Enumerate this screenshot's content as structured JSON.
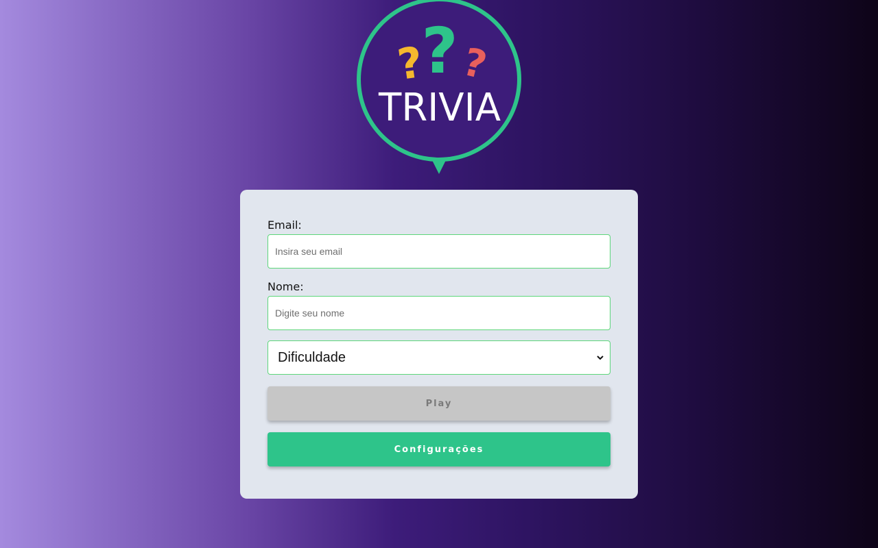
{
  "logo": {
    "wordmark": "TRIVIA",
    "icon": "question-marks-icon",
    "colors": {
      "ring": "#2ec48a",
      "disc": "#3d1c7a",
      "q_left": "#f5b82e",
      "q_center": "#2ec48a",
      "q_right": "#e9605c"
    }
  },
  "form": {
    "email_label": "Email:",
    "email_placeholder": "Insira seu email",
    "email_value": "",
    "name_label": "Nome:",
    "name_placeholder": "Digite seu nome",
    "name_value": "",
    "difficulty_selected": "Dificuldade",
    "play_label": "Play",
    "settings_label": "Configurações"
  },
  "colors": {
    "accent": "#2ec48a",
    "input_border": "#5cd67a",
    "card_bg": "#e1e6ee",
    "play_disabled_bg": "#c6c6c6"
  }
}
